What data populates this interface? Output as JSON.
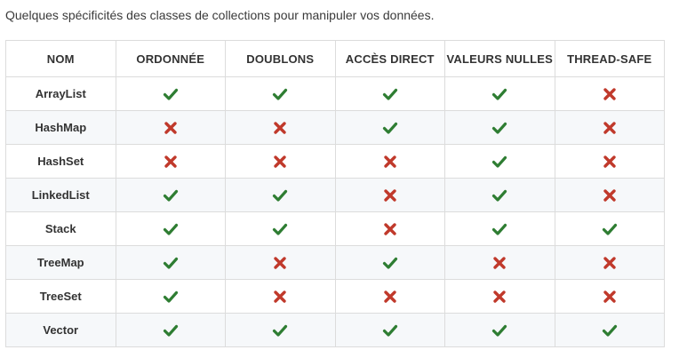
{
  "caption": "Quelques spécificités des classes de collections pour manipuler vos données.",
  "colors": {
    "check": "#2e7d32",
    "cross": "#c0392b"
  },
  "table": {
    "headers": [
      "NOM",
      "ORDONNÉE",
      "DOUBLONS",
      "ACCÈS DIRECT",
      "VALEURS NULLES",
      "THREAD-SAFE"
    ],
    "rows": [
      {
        "name": "ArrayList",
        "values": [
          true,
          true,
          true,
          true,
          false
        ]
      },
      {
        "name": "HashMap",
        "values": [
          false,
          false,
          true,
          true,
          false
        ]
      },
      {
        "name": "HashSet",
        "values": [
          false,
          false,
          false,
          true,
          false
        ]
      },
      {
        "name": "LinkedList",
        "values": [
          true,
          true,
          false,
          true,
          false
        ]
      },
      {
        "name": "Stack",
        "values": [
          true,
          true,
          false,
          true,
          true
        ]
      },
      {
        "name": "TreeMap",
        "values": [
          true,
          false,
          true,
          false,
          false
        ]
      },
      {
        "name": "TreeSet",
        "values": [
          true,
          false,
          false,
          false,
          false
        ]
      },
      {
        "name": "Vector",
        "values": [
          true,
          true,
          true,
          true,
          true
        ]
      }
    ]
  },
  "icons": {
    "yes": "check-icon",
    "no": "cross-icon"
  }
}
